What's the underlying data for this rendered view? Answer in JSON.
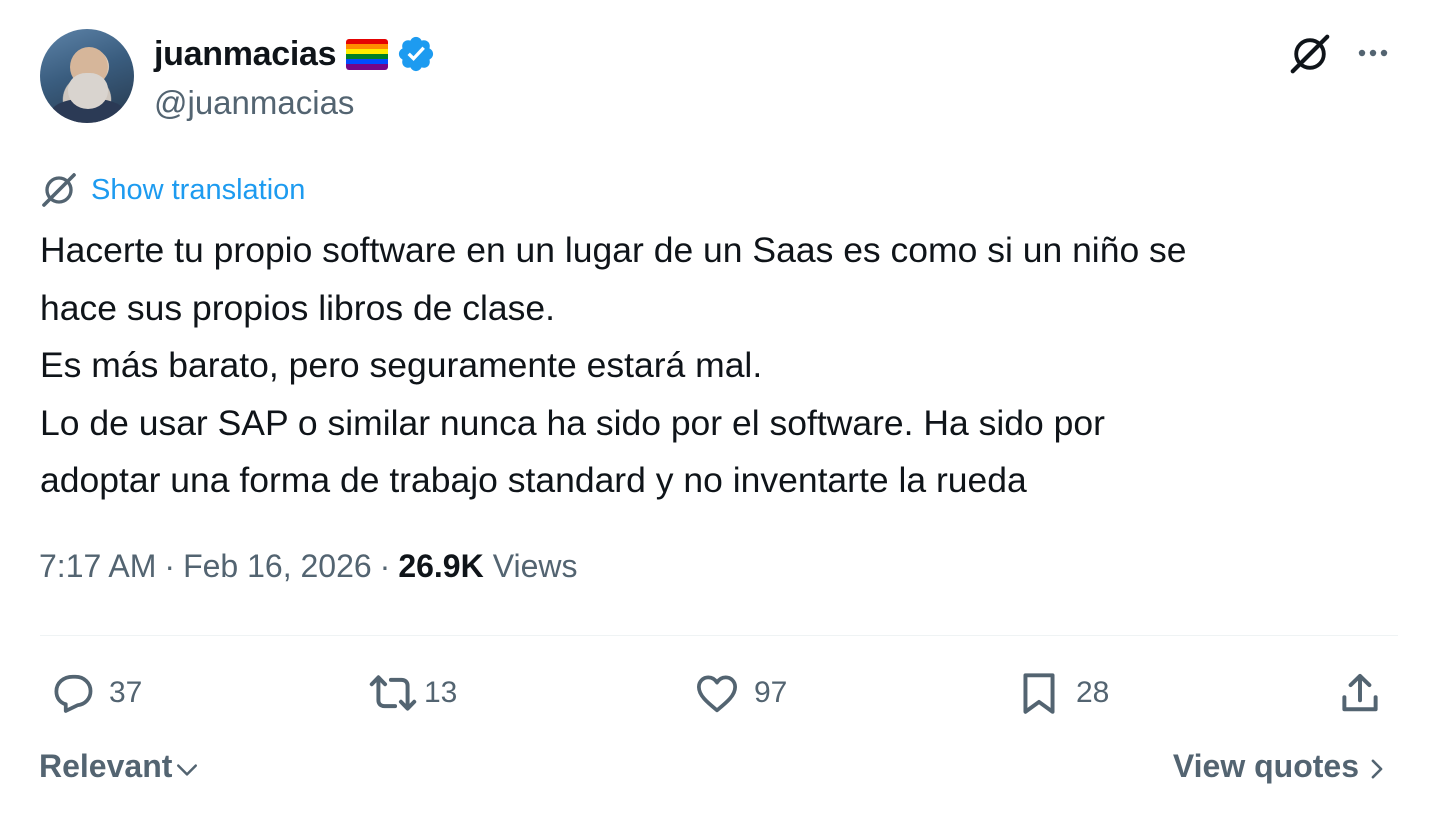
{
  "author": {
    "display_name": "juanmacias",
    "handle": "@juanmacias",
    "flag_icon": "rainbow-flag-icon",
    "flag_colors": [
      "#e40303",
      "#ff8c00",
      "#ffed00",
      "#008026",
      "#004dff",
      "#750787"
    ],
    "verified_icon": "verified-badge-icon",
    "verified_color": "#1d9bf0"
  },
  "header_actions": {
    "grok_icon": "grok-icon",
    "more_icon": "more-icon"
  },
  "translation": {
    "icon": "grok-icon",
    "label": "Show translation",
    "color": "#1d9bf0"
  },
  "tweet": {
    "lines": [
      "Hacerte tu propio software en un lugar de un Saas es como si un niño se",
      "hace sus propios libros de clase.",
      "Es más barato, pero seguramente estará mal.",
      "Lo de usar SAP o similar nunca ha sido por el software. Ha sido por",
      "adoptar una forma de trabajo standard y no inventarte la rueda"
    ]
  },
  "meta": {
    "time": "7:17 AM",
    "separator": "·",
    "date": "Feb 16, 2026",
    "views_count": "26.9K",
    "views_label": "Views"
  },
  "actions": {
    "replies": {
      "icon": "reply-icon",
      "count": "37"
    },
    "reposts": {
      "icon": "repost-icon",
      "count": "13"
    },
    "likes": {
      "icon": "like-icon",
      "count": "97"
    },
    "bookmarks": {
      "icon": "bookmark-icon",
      "count": "28"
    },
    "share": {
      "icon": "share-icon"
    }
  },
  "footer": {
    "sort_label": "Relevant",
    "sort_icon": "chevron-down-icon",
    "quotes_label": "View quotes",
    "quotes_icon": "chevron-right-icon"
  }
}
